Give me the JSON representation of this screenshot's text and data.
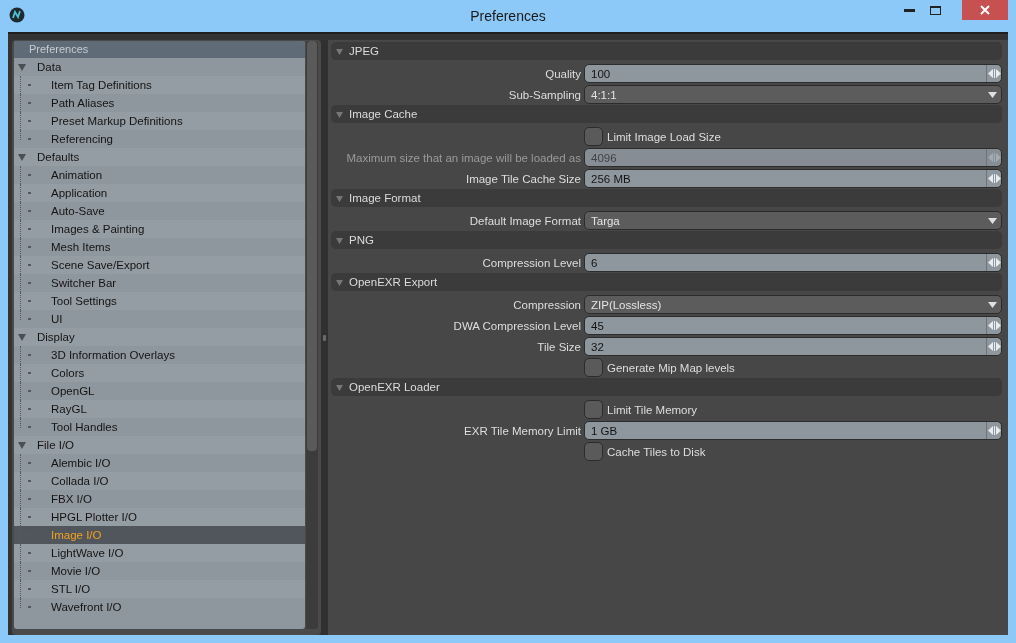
{
  "window": {
    "title": "Preferences"
  },
  "tree": {
    "header": "Preferences",
    "groups": [
      {
        "label": "Data",
        "expanded": true,
        "children": [
          {
            "label": "Item Tag Definitions",
            "selected": false
          },
          {
            "label": "Path Aliases",
            "selected": false
          },
          {
            "label": "Preset Markup Definitions",
            "selected": false
          },
          {
            "label": "Referencing",
            "selected": false
          }
        ]
      },
      {
        "label": "Defaults",
        "expanded": true,
        "children": [
          {
            "label": "Animation",
            "selected": false
          },
          {
            "label": "Application",
            "selected": false
          },
          {
            "label": "Auto-Save",
            "selected": false
          },
          {
            "label": "Images & Painting",
            "selected": false
          },
          {
            "label": "Mesh Items",
            "selected": false
          },
          {
            "label": "Scene Save/Export",
            "selected": false
          },
          {
            "label": "Switcher Bar",
            "selected": false
          },
          {
            "label": "Tool Settings",
            "selected": false
          },
          {
            "label": "UI",
            "selected": false
          }
        ]
      },
      {
        "label": "Display",
        "expanded": true,
        "children": [
          {
            "label": "3D Information Overlays",
            "selected": false
          },
          {
            "label": "Colors",
            "selected": false
          },
          {
            "label": "OpenGL",
            "selected": false
          },
          {
            "label": "RayGL",
            "selected": false
          },
          {
            "label": "Tool Handles",
            "selected": false
          }
        ]
      },
      {
        "label": "File I/O",
        "expanded": true,
        "children": [
          {
            "label": "Alembic I/O",
            "selected": false
          },
          {
            "label": "Collada I/O",
            "selected": false
          },
          {
            "label": "FBX I/O",
            "selected": false
          },
          {
            "label": "HPGL Plotter I/O",
            "selected": false
          },
          {
            "label": "Image I/O",
            "selected": true
          },
          {
            "label": "LightWave I/O",
            "selected": false
          },
          {
            "label": "Movie I/O",
            "selected": false
          },
          {
            "label": "STL I/O",
            "selected": false
          },
          {
            "label": "Wavefront I/O",
            "selected": false
          }
        ]
      }
    ]
  },
  "sections": [
    {
      "title": "JPEG",
      "expanded": true,
      "rows": [
        {
          "kind": "number",
          "label": "Quality",
          "value": "100",
          "disabled": false
        },
        {
          "kind": "dropdown",
          "label": "Sub-Sampling",
          "value": "4:1:1"
        }
      ]
    },
    {
      "title": "Image Cache",
      "expanded": true,
      "rows": [
        {
          "kind": "checkbox",
          "label": "Limit Image Load Size",
          "checked": false
        },
        {
          "kind": "number",
          "label": "Maximum size that an image will be loaded as",
          "value": "4096",
          "disabled": true
        },
        {
          "kind": "number",
          "label": "Image Tile Cache Size",
          "value": "256 MB",
          "disabled": false
        }
      ]
    },
    {
      "title": "Image Format",
      "expanded": true,
      "rows": [
        {
          "kind": "dropdown",
          "label": "Default Image Format",
          "value": "Targa"
        }
      ]
    },
    {
      "title": "PNG",
      "expanded": true,
      "rows": [
        {
          "kind": "number",
          "label": "Compression Level",
          "value": "6",
          "disabled": false
        }
      ]
    },
    {
      "title": "OpenEXR Export",
      "expanded": true,
      "rows": [
        {
          "kind": "dropdown",
          "label": "Compression",
          "value": "ZIP(Lossless)"
        },
        {
          "kind": "number",
          "label": "DWA Compression Level",
          "value": "45",
          "disabled": false
        },
        {
          "kind": "number",
          "label": "Tile Size",
          "value": "32",
          "disabled": false
        },
        {
          "kind": "checkbox",
          "label": "Generate Mip Map levels",
          "checked": false
        }
      ]
    },
    {
      "title": "OpenEXR Loader",
      "expanded": true,
      "rows": [
        {
          "kind": "checkbox",
          "label": "Limit Tile Memory",
          "checked": false
        },
        {
          "kind": "number",
          "label": "EXR Tile Memory Limit",
          "value": "1 GB",
          "disabled": false
        },
        {
          "kind": "checkbox",
          "label": "Cache Tiles to Disk",
          "checked": false
        }
      ]
    }
  ]
}
